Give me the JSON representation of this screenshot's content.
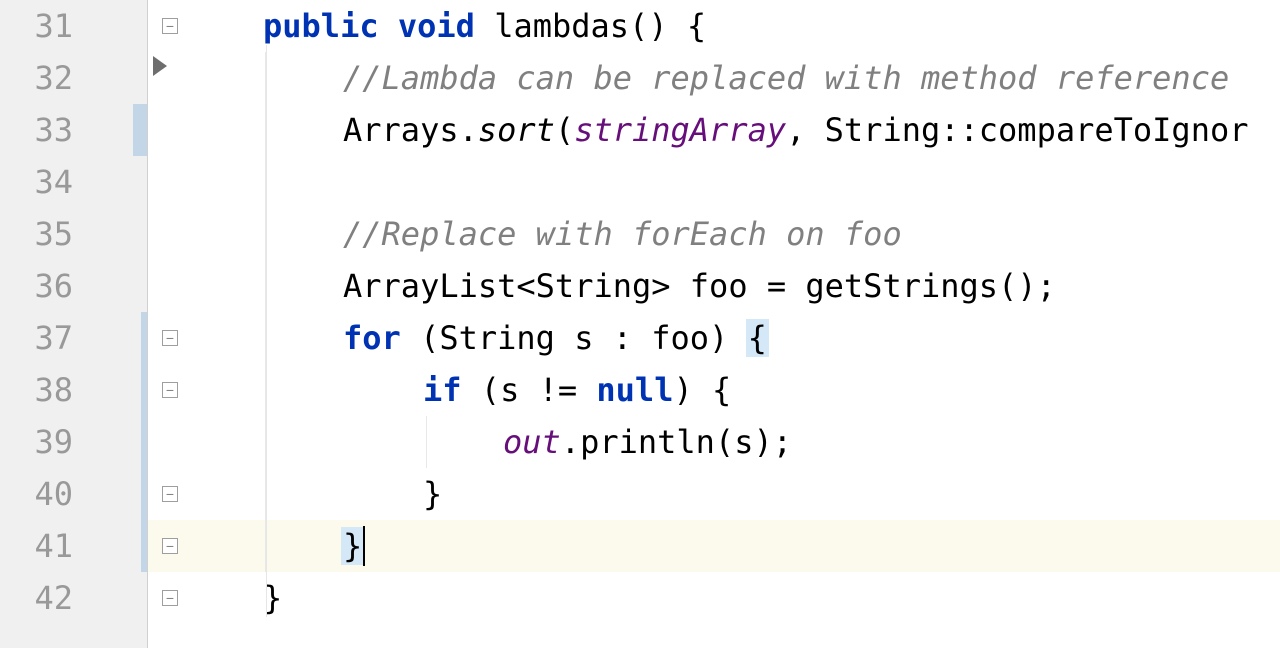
{
  "editor": {
    "lines": [
      {
        "n": 31,
        "hasRun": true,
        "hasFold": true,
        "indent": 1,
        "tokens": [
          {
            "t": "public",
            "c": "kw"
          },
          {
            "t": " ",
            "c": "default"
          },
          {
            "t": "void",
            "c": "kw"
          },
          {
            "t": " ",
            "c": "default"
          },
          {
            "t": "lambdas() {",
            "c": "default"
          }
        ]
      },
      {
        "n": 32,
        "indent": 2,
        "tokens": [
          {
            "t": "//Lambda can be replaced with method reference",
            "c": "comment"
          }
        ]
      },
      {
        "n": 33,
        "indent": 2,
        "change": true,
        "tokens": [
          {
            "t": "Arrays.",
            "c": "default"
          },
          {
            "t": "sort",
            "c": "method"
          },
          {
            "t": "(",
            "c": "default"
          },
          {
            "t": "stringArray",
            "c": "field"
          },
          {
            "t": ", String::compareToIgnor",
            "c": "default"
          }
        ]
      },
      {
        "n": 34,
        "indent": 2,
        "tokens": []
      },
      {
        "n": 35,
        "indent": 2,
        "tokens": [
          {
            "t": "//Replace with forEach on foo",
            "c": "comment"
          }
        ]
      },
      {
        "n": 36,
        "indent": 2,
        "tokens": [
          {
            "t": "ArrayList<String> foo = getStrings();",
            "c": "default"
          }
        ]
      },
      {
        "n": 37,
        "indent": 2,
        "hasFold": true,
        "change2": true,
        "tokens": [
          {
            "t": "for",
            "c": "kw"
          },
          {
            "t": " (String s : foo) ",
            "c": "default"
          },
          {
            "t": "{",
            "c": "default",
            "hl": true
          }
        ]
      },
      {
        "n": 38,
        "indent": 3,
        "hasFold": true,
        "change2": true,
        "tokens": [
          {
            "t": "if",
            "c": "kw"
          },
          {
            "t": " (s != ",
            "c": "default"
          },
          {
            "t": "null",
            "c": "kw"
          },
          {
            "t": ") {",
            "c": "default"
          }
        ]
      },
      {
        "n": 39,
        "indent": 4,
        "change2": true,
        "tokens": [
          {
            "t": "out",
            "c": "static-field"
          },
          {
            "t": ".println(s);",
            "c": "default"
          }
        ]
      },
      {
        "n": 40,
        "indent": 3,
        "hasFold": true,
        "change2": true,
        "tokens": [
          {
            "t": "}",
            "c": "default"
          }
        ]
      },
      {
        "n": 41,
        "indent": 2,
        "hasFold": true,
        "change2": true,
        "current": true,
        "cursorAfter": true,
        "tokens": [
          {
            "t": "}",
            "c": "default",
            "hl": true
          }
        ]
      },
      {
        "n": 42,
        "indent": 1,
        "hasFold": true,
        "tokens": [
          {
            "t": "}",
            "c": "default"
          }
        ]
      }
    ]
  },
  "colors": {
    "keyword": "#0033b3",
    "comment": "#808080",
    "field": "#660e7a",
    "currentLine": "#fcfaed",
    "bracketHighlight": "#d4e8f8",
    "gutterBg": "#f0f0f0",
    "changeMarker": "#c3d6e8"
  }
}
